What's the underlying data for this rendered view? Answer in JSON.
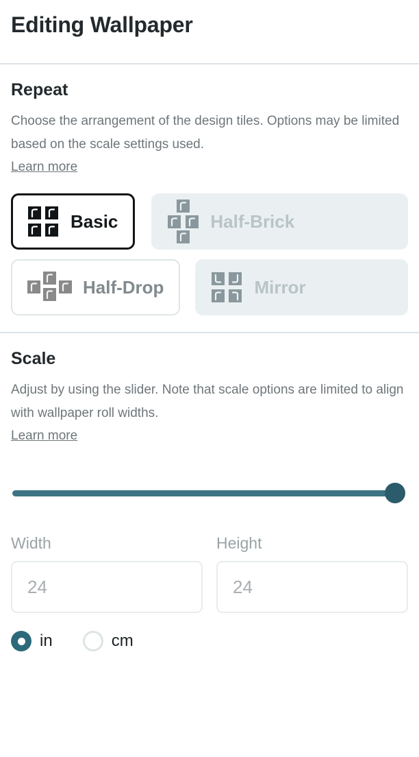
{
  "header": {
    "title": "Editing Wallpaper"
  },
  "repeat": {
    "title": "Repeat",
    "description": "Choose the arrangement of the design tiles. Options may be limited based on the scale settings used.",
    "learn_more": "Learn more",
    "options": [
      {
        "label": "Basic",
        "icon": "tile-grid-basic-icon",
        "state": "selected",
        "selected": true,
        "disabled": false
      },
      {
        "label": "Half-Brick",
        "icon": "tile-grid-halfbrick-icon",
        "state": "disabled",
        "selected": false,
        "disabled": true
      },
      {
        "label": "Half-Drop",
        "icon": "tile-grid-halfdrop-icon",
        "state": "enabled",
        "selected": false,
        "disabled": false
      },
      {
        "label": "Mirror",
        "icon": "tile-grid-mirror-icon",
        "state": "disabled",
        "selected": false,
        "disabled": true
      }
    ]
  },
  "scale": {
    "title": "Scale",
    "description": "Adjust by using the slider. Note that scale options are limited to align with wallpaper roll widths.",
    "learn_more": "Learn more",
    "slider": {
      "value_percent": 100,
      "min": 0,
      "max": 100
    },
    "width": {
      "label": "Width",
      "value": "",
      "placeholder": "24"
    },
    "height": {
      "label": "Height",
      "value": "",
      "placeholder": "24"
    },
    "units": {
      "selected": "in",
      "options": [
        {
          "label": "in",
          "selected": true
        },
        {
          "label": "cm",
          "selected": false
        }
      ]
    }
  },
  "colors": {
    "accent_teal": "#2c6a7a",
    "slider_track": "#3d7484",
    "slider_thumb": "#2c5c6c",
    "selected_border": "#111517",
    "disabled_bg": "#eaf0f1",
    "disabled_text": "#b9c4c8",
    "divider": "#dce3e6",
    "text_dark": "#23292c",
    "text_muted": "#6e767a"
  }
}
